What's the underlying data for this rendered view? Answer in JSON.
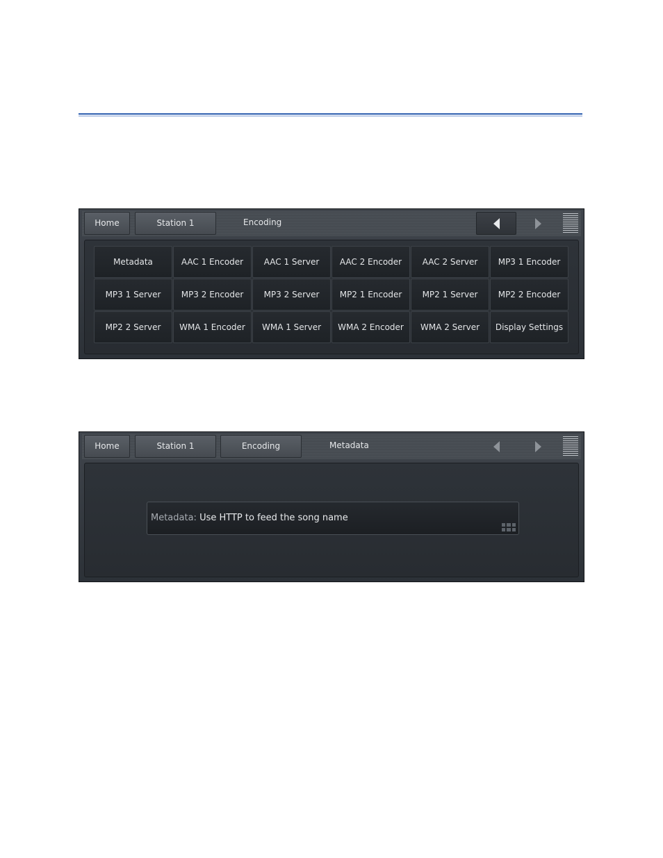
{
  "panel_a": {
    "tabs": {
      "home": "Home",
      "station": "Station 1"
    },
    "current": "Encoding",
    "buttons": [
      "Metadata",
      "AAC 1 Encoder",
      "AAC 1 Server",
      "AAC 2 Encoder",
      "AAC 2 Server",
      "MP3 1 Encoder",
      "MP3 1 Server",
      "MP3 2 Encoder",
      "MP3 2 Server",
      "MP2 1 Encoder",
      "MP2 1 Server",
      "MP2 2 Encoder",
      "MP2 2 Server",
      "WMA 1 Encoder",
      "WMA 1 Server",
      "WMA 2 Encoder",
      "WMA 2 Server",
      "Display Settings"
    ]
  },
  "panel_b": {
    "tabs": {
      "home": "Home",
      "station": "Station 1",
      "encoding": "Encoding"
    },
    "current": "Metadata",
    "field": {
      "label": "Metadata: ",
      "value": "Use HTTP to feed the song name"
    }
  },
  "icons": [
    "triangle-left-icon",
    "triangle-right-icon",
    "menu-lines-icon",
    "keyboard-icon"
  ],
  "colors": {
    "accent_rule": "#2f5fb0",
    "panel_bg": "#2c3137",
    "text": "#e6e8ea"
  }
}
